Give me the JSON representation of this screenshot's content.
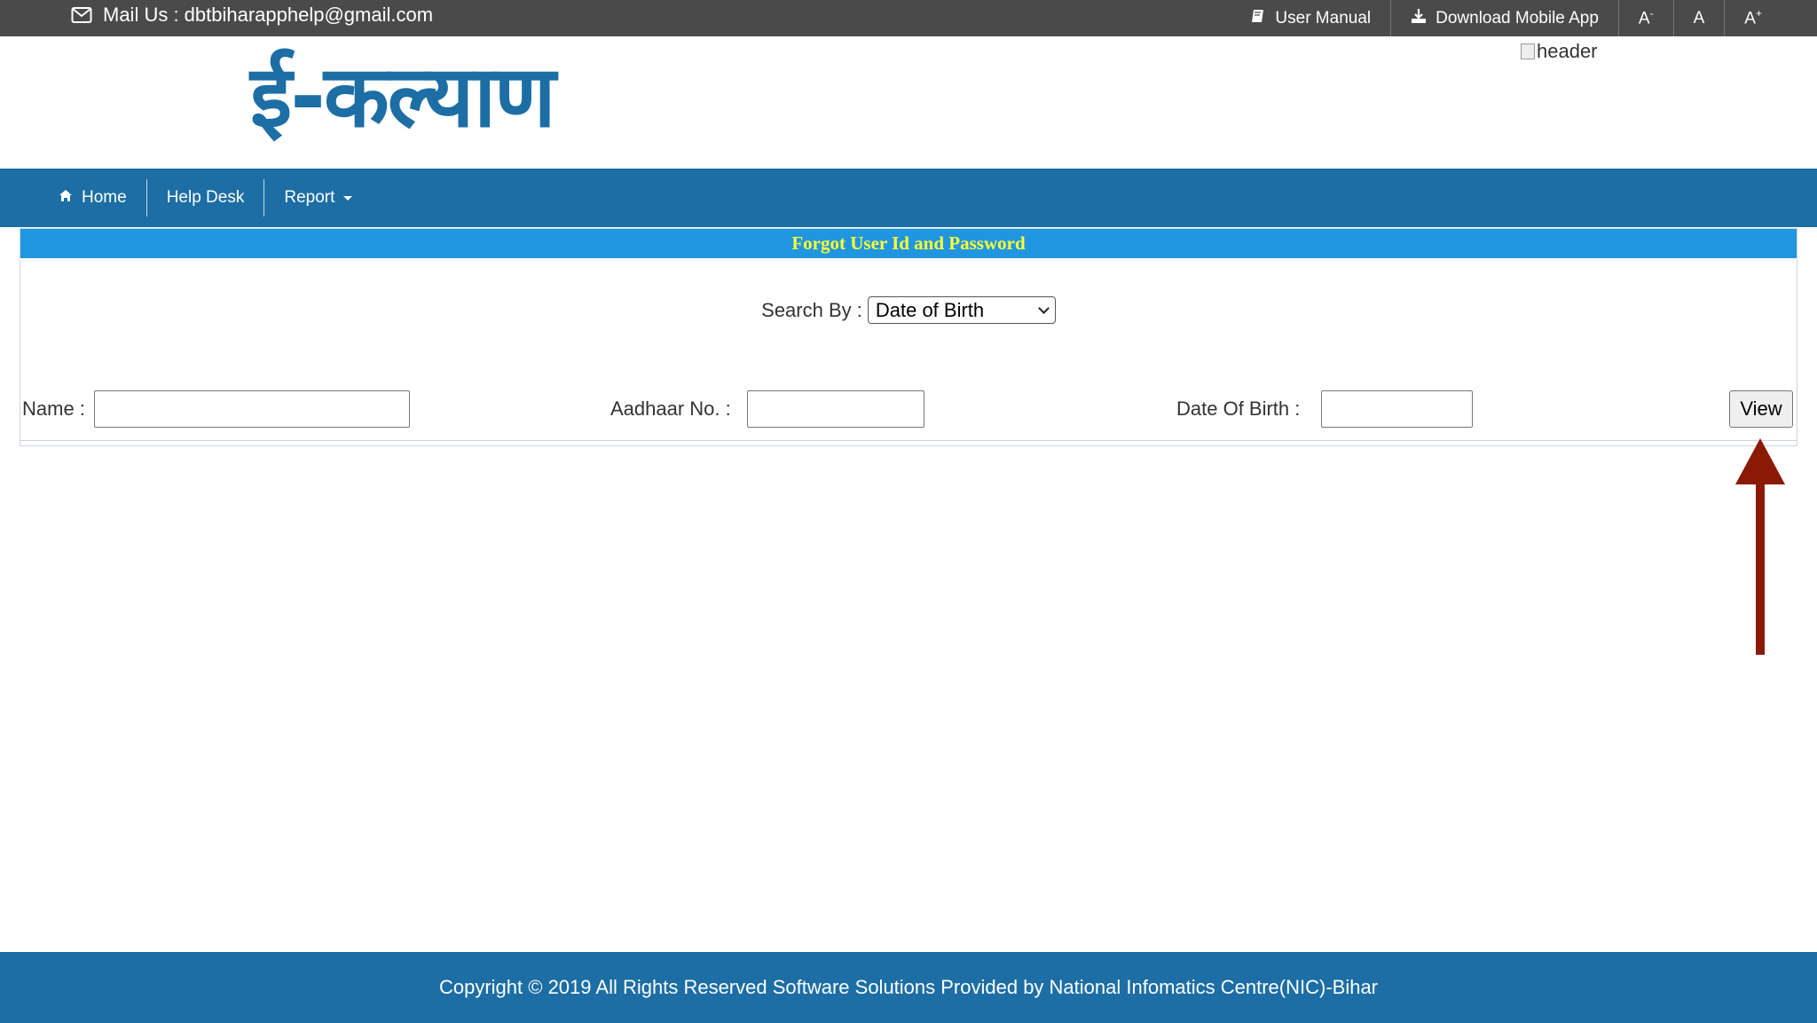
{
  "topbar": {
    "mail_text": "Mail Us : dbtbiharapphelp@gmail.com",
    "links": {
      "user_manual": "User Manual",
      "download_app": "Download Mobile App",
      "font_decrease": "A",
      "font_decrease_sup": "-",
      "font_normal": "A",
      "font_increase": "A",
      "font_increase_sup": "+"
    }
  },
  "header": {
    "logo_text": "ई-कल्याण",
    "header_image_alt": "header"
  },
  "nav": {
    "home": "Home",
    "help_desk": "Help Desk",
    "report": "Report"
  },
  "panel": {
    "title": "Forgot User Id and Password",
    "search_by_label": "Search By :",
    "search_by_value": "Date of Birth",
    "name_label": "Name :",
    "aadhaar_label": "Aadhaar No. :",
    "dob_label": "Date Of Birth :",
    "view_button": "View"
  },
  "footer": {
    "copyright": "Copyright © 2019 All Rights Reserved Software Solutions Provided by National Infomatics Centre(NIC)-Bihar"
  },
  "colors": {
    "topbar_bg": "#4a4a4a",
    "brand_blue": "#1c6ea4",
    "panel_head_bg": "#2196e0",
    "panel_head_text": "#ffff33",
    "arrow": "#8b1a05"
  }
}
